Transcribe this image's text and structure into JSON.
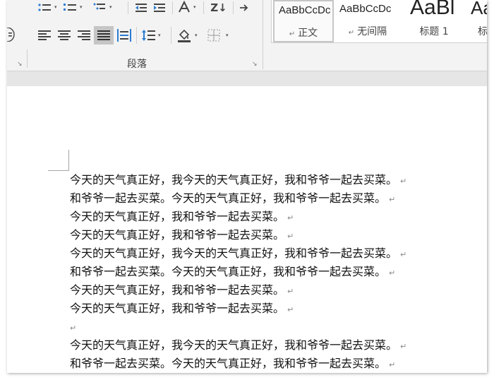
{
  "ribbon": {
    "group_label": "段落",
    "styles": [
      {
        "sample": "AaBbCcDc",
        "name": "正文"
      },
      {
        "sample": "AaBbCcDc",
        "name": "无间隔"
      },
      {
        "sample": "AaBl",
        "name": "标题 1"
      },
      {
        "sample": "Aa",
        "name": "标"
      }
    ],
    "sort_label": "Z↓",
    "paragraph_mark_glyph": "↵",
    "dropdown_glyph": "▾",
    "launcher_glyph": "↘",
    "style_arrow_glyph": "↵"
  },
  "document": {
    "lines": [
      "今天的天气真正好，我今天的天气真正好，我和爷爷一起去买菜。",
      "和爷爷一起去买菜。今天的天气真正好，我和爷爷一起去买菜。",
      "今天的天气真正好，我和爷爷一起去买菜。",
      "今天的天气真正好，我和爷爷一起去买菜。",
      "今天的天气真正好，我今天的天气真正好，我和爷爷一起去买菜。",
      "和爷爷一起去买菜。今天的天气真正好，我和爷爷一起去买菜。",
      "今天的天气真正好，我和爷爷一起去买菜。",
      "今天的天气真正好，我和爷爷一起去买菜。",
      "",
      "今天的天气真正好，我今天的天气真正好，我和爷爷一起去买菜。",
      "和爷爷一起去买菜。今天的天气真正好，我和爷爷一起去买菜。"
    ]
  },
  "icons": {
    "bullets": "list-bullets-icon",
    "numbering": "list-numbering-icon",
    "multilevel": "multilevel-list-icon",
    "decrease_indent": "decrease-indent-icon",
    "increase_indent": "increase-indent-icon",
    "chinese_layout": "chinese-layout-icon",
    "sort": "sort-icon",
    "show_marks": "show-hide-marks-icon",
    "enclose": "enclose-character-icon",
    "align_left": "align-left-icon",
    "align_center": "align-center-icon",
    "align_right": "align-right-icon",
    "justify": "justify-icon",
    "distributed": "distributed-icon",
    "line_spacing": "line-spacing-icon",
    "shading": "shading-icon",
    "borders": "borders-icon"
  },
  "colors": {
    "ribbon_bg": "#f3f3f3",
    "active_button": "#c5c5c5",
    "icon": "#444444",
    "accent_blue": "#2b7cd3"
  }
}
